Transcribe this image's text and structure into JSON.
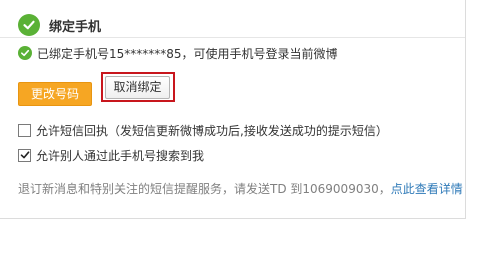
{
  "section": {
    "title": "绑定手机",
    "header_icon": "check-circle-icon"
  },
  "status": {
    "icon": "check-circle-icon",
    "text": "已绑定手机号15*******85，可使用手机号登录当前微博"
  },
  "buttons": {
    "change_number": "更改号码",
    "unbind": "取消绑定"
  },
  "options": [
    {
      "label": "允许短信回执（发短信更新微博成功后,接收发送成功的提示短信）",
      "checked": false
    },
    {
      "label": "允许别人通过此手机号搜索到我",
      "checked": true
    }
  ],
  "info": {
    "text": "退订新消息和特别关注的短信提醒服务，请发送TD 到1069009030，",
    "link": "点此查看详情"
  },
  "colors": {
    "accent_green": "#5ab136",
    "button_orange": "#f6a623",
    "highlight_red": "#c8161d",
    "link_blue": "#2f7ab8"
  }
}
